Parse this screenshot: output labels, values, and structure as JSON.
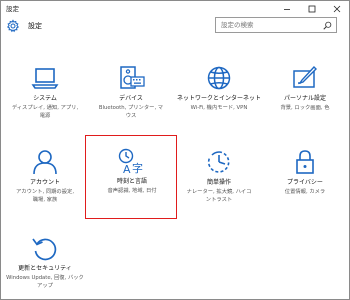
{
  "window": {
    "title": "設定"
  },
  "header": {
    "title": "設定",
    "search_placeholder": "設定の検索"
  },
  "tiles": [
    {
      "label": "システム",
      "desc_line1": "ディスプレイ, 通知, アプリ,",
      "desc_line2": "電源",
      "icon": "laptop-icon"
    },
    {
      "label": "デバイス",
      "desc_line1": "Bluetooth, プリンター, マ",
      "desc_line2": "ウス",
      "icon": "keyboard-speaker-icon"
    },
    {
      "label": "ネットワークとインターネット",
      "desc_line1": "Wi-Fi, 機内モード, VPN",
      "desc_line2": "",
      "icon": "globe-icon"
    },
    {
      "label": "パーソナル設定",
      "desc_line1": "背景, ロック画面, 色",
      "desc_line2": "",
      "icon": "paint-icon"
    },
    {
      "label": "アカウント",
      "desc_line1": "アカウント, 同期の設定,",
      "desc_line2": "職場, 家族",
      "icon": "person-icon"
    },
    {
      "label": "時刻と言語",
      "desc_line1": "音声認識, 地域, 日付",
      "desc_line2": "",
      "icon": "time-language-icon"
    },
    {
      "label": "簡単操作",
      "desc_line1": "ナレーター, 拡大鏡, ハイコ",
      "desc_line2": "ントラスト",
      "icon": "ease-of-access-icon"
    },
    {
      "label": "プライバシー",
      "desc_line1": "位置情報, カメラ",
      "desc_line2": "",
      "icon": "lock-icon"
    },
    {
      "label": "更新とセキュリティ",
      "desc_line1": "Windows Update, 回復, バック",
      "desc_line2": "アップ",
      "icon": "refresh-icon"
    }
  ],
  "colors": {
    "accent": "#1e68c2",
    "selection_border": "#e01c1c"
  }
}
